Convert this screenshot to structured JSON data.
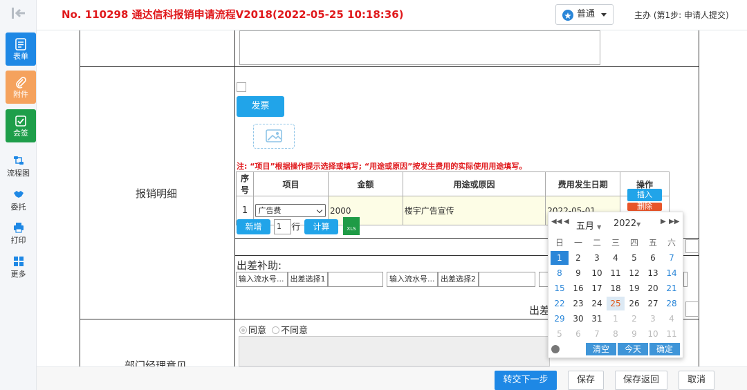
{
  "header": {
    "title": "No. 110298 通达信科报销申请流程V2018(2022-05-25 10:18:36)",
    "level_label": "普通",
    "step_text": "主办 (第1步:  申请人提交)"
  },
  "sidebar": {
    "tiles": [
      {
        "label": "表单",
        "icon": "form-icon",
        "color": "#1e88e5"
      },
      {
        "label": "附件",
        "icon": "paperclip-icon",
        "color": "#f5a25d"
      },
      {
        "label": "会签",
        "icon": "checkbox-icon",
        "color": "#1e9e4a"
      }
    ],
    "links": [
      {
        "label": "流程图",
        "icon": "flowchart-icon"
      },
      {
        "label": "委托",
        "icon": "handshake-icon"
      },
      {
        "label": "打印",
        "icon": "printer-icon"
      },
      {
        "label": "更多",
        "icon": "grid-icon"
      }
    ]
  },
  "form": {
    "detail_label": "报销明细",
    "invoice_button": "发票",
    "note": "注: “项目”根据操作提示选择或填写; “用途或原因”按发生费用的实际使用用途填写。",
    "table_headers": [
      "序号",
      "项目",
      "金额",
      "用途或原因",
      "费用发生日期",
      "操作"
    ],
    "row": {
      "index": "1",
      "item": "广告费",
      "amount": "2000",
      "reason": "楼宇广告宣传",
      "date": "2022-05-01"
    },
    "insert_button": "插入",
    "delete_button": "删除",
    "add_button": "新增",
    "row_count": "1",
    "row_unit": "行",
    "calc_button": "计算",
    "xls_label": "XLS",
    "travel_label": "出差补助:",
    "serial_placeholder_1": "输入流水号...",
    "travel_select_1": "出差选择1",
    "serial_placeholder_2": "输入流水号...",
    "travel_select_2": "出差选择2",
    "travel_total_label": "出差",
    "opinion_agree": "同意",
    "opinion_disagree": "不同意",
    "manager_label": "部门经理意见"
  },
  "calendar": {
    "month": "五月",
    "year": "2022",
    "weekdays": [
      "日",
      "一",
      "二",
      "三",
      "四",
      "五",
      "六"
    ],
    "weeks": [
      [
        "1",
        "2",
        "3",
        "4",
        "5",
        "6",
        "7"
      ],
      [
        "8",
        "9",
        "10",
        "11",
        "12",
        "13",
        "14"
      ],
      [
        "15",
        "16",
        "17",
        "18",
        "19",
        "20",
        "21"
      ],
      [
        "22",
        "23",
        "24",
        "25",
        "26",
        "27",
        "28"
      ],
      [
        "29",
        "30",
        "31",
        "1",
        "2",
        "3",
        "4"
      ],
      [
        "5",
        "6",
        "7",
        "8",
        "9",
        "10",
        "11"
      ]
    ],
    "selected_day": "1",
    "today_day": "25",
    "clear_button": "清空",
    "today_button": "今天",
    "confirm_button": "确定"
  },
  "footer": {
    "next_button": "转交下一步",
    "save_button": "保存",
    "save_return_button": "保存返回",
    "cancel_button": "取消"
  }
}
